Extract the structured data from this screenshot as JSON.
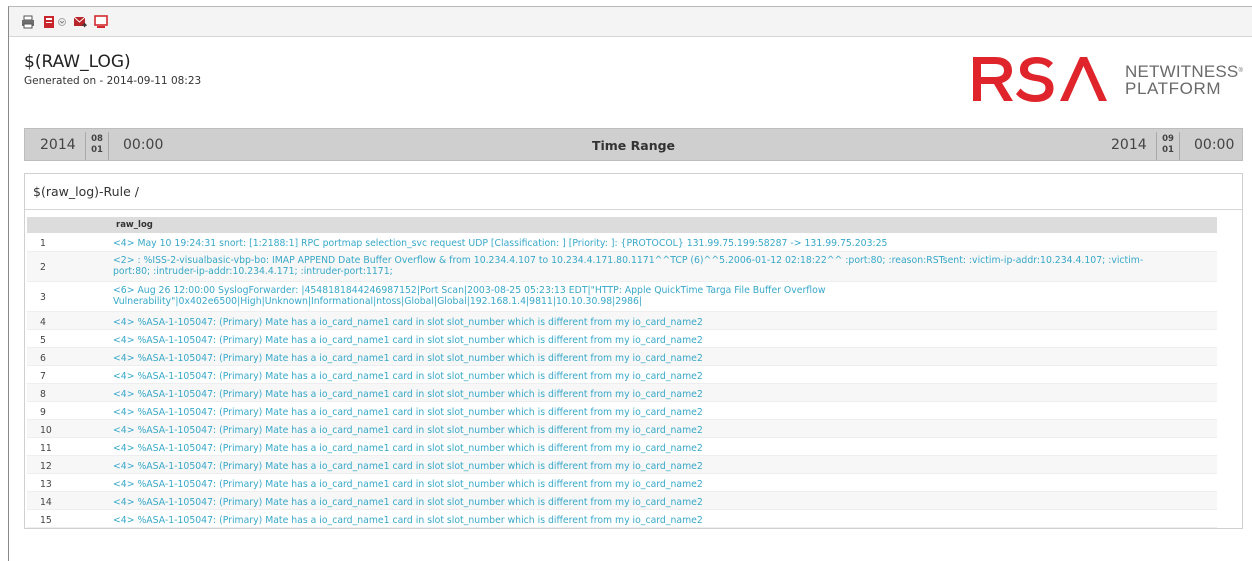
{
  "toolbar": {
    "icons": [
      "print-icon",
      "export-icon",
      "dropdown-caret-icon",
      "email-icon",
      "pdf-icon"
    ]
  },
  "report": {
    "title": "$(RAW_LOG)",
    "generated": "Generated on - 2014-09-11 08:23"
  },
  "logo": {
    "brand": "RSA",
    "line1": "NETWITNESS",
    "line2": "PLATFORM",
    "reg": "®",
    "color": "#e0242b"
  },
  "time_range": {
    "label": "Time Range",
    "start": {
      "year": "2014",
      "month": "08",
      "day": "01",
      "time": "00:00"
    },
    "end": {
      "year": "2014",
      "month": "09",
      "day": "01",
      "time": "00:00"
    }
  },
  "rule": {
    "title": "$(raw_log)-Rule /",
    "column": "raw_log",
    "rows": [
      {
        "n": "1",
        "log": "<4> May 10 19:24:31 snort: [1:2188:1] RPC portmap selection_svc request UDP [Classification: ] [Priority: ]: {PROTOCOL} 131.99.75.199:58287 -> 131.99.75.203:25"
      },
      {
        "n": "2",
        "log": "<2> : %ISS-2-visualbasic-vbp-bo: IMAP APPEND Date Buffer Overflow & from 10.234.4.107 to 10.234.4.171.80.1171^^TCP (6)^^5.2006-01-12 02:18:22^^ :port:80; :reason:RSTsent: :victim-ip-addr:10.234.4.107; :victim-port:80; :intruder-ip-addr:10.234.4.171; :intruder-port:1171;"
      },
      {
        "n": "3",
        "log": "<6> Aug 26 12:00:00 SyslogForwarder: |4548181844246987152|Port Scan|2003-08-25 05:23:13 EDT|\"HTTP: Apple QuickTime Targa File Buffer Overflow Vulnerability\"|0x402e6500|High|Unknown|Informational|ntoss|Global|Global|192.168.1.4|9811|10.10.30.98|2986|"
      },
      {
        "n": "4",
        "log": "<4> %ASA-1-105047: (Primary) Mate has a io_card_name1 card in slot slot_number which is different from my io_card_name2"
      },
      {
        "n": "5",
        "log": "<4> %ASA-1-105047: (Primary) Mate has a io_card_name1 card in slot slot_number which is different from my io_card_name2"
      },
      {
        "n": "6",
        "log": "<4> %ASA-1-105047: (Primary) Mate has a io_card_name1 card in slot slot_number which is different from my io_card_name2"
      },
      {
        "n": "7",
        "log": "<4> %ASA-1-105047: (Primary) Mate has a io_card_name1 card in slot slot_number which is different from my io_card_name2"
      },
      {
        "n": "8",
        "log": "<4> %ASA-1-105047: (Primary) Mate has a io_card_name1 card in slot slot_number which is different from my io_card_name2"
      },
      {
        "n": "9",
        "log": "<4> %ASA-1-105047: (Primary) Mate has a io_card_name1 card in slot slot_number which is different from my io_card_name2"
      },
      {
        "n": "10",
        "log": "<4> %ASA-1-105047: (Primary) Mate has a io_card_name1 card in slot slot_number which is different from my io_card_name2"
      },
      {
        "n": "11",
        "log": "<4> %ASA-1-105047: (Primary) Mate has a io_card_name1 card in slot slot_number which is different from my io_card_name2"
      },
      {
        "n": "12",
        "log": "<4> %ASA-1-105047: (Primary) Mate has a io_card_name1 card in slot slot_number which is different from my io_card_name2"
      },
      {
        "n": "13",
        "log": "<4> %ASA-1-105047: (Primary) Mate has a io_card_name1 card in slot slot_number which is different from my io_card_name2"
      },
      {
        "n": "14",
        "log": "<4> %ASA-1-105047: (Primary) Mate has a io_card_name1 card in slot slot_number which is different from my io_card_name2"
      },
      {
        "n": "15",
        "log": "<4> %ASA-1-105047: (Primary) Mate has a io_card_name1 card in slot slot_number which is different from my io_card_name2"
      }
    ]
  },
  "colors": {
    "accent": "#e0242b",
    "log_text": "#37a8c8",
    "header_bg": "#dcdcdc",
    "timebar_bg": "#cfcfcf"
  }
}
